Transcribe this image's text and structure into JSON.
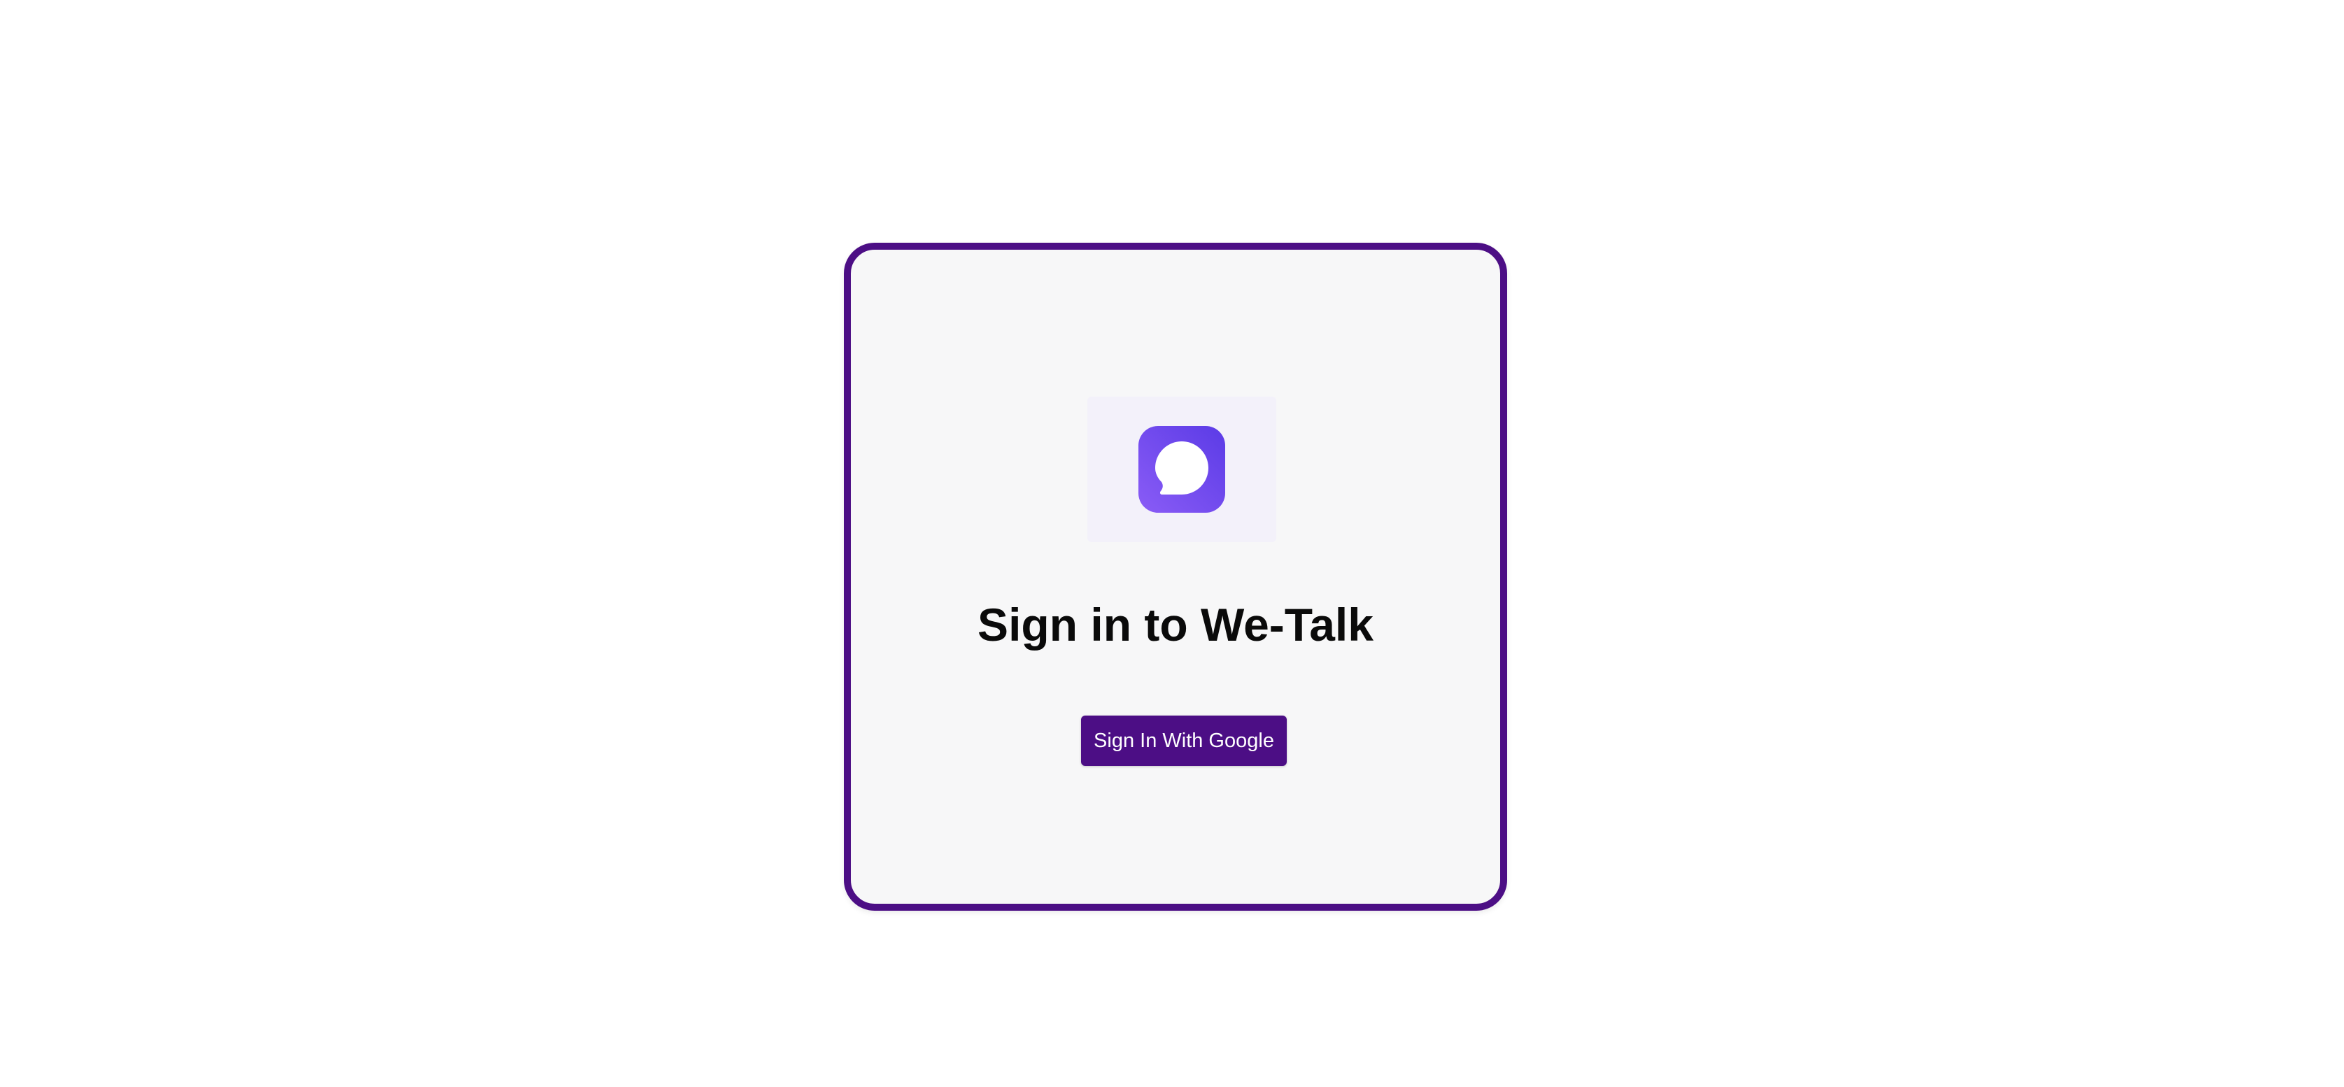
{
  "colors": {
    "accent": "#4c0e85",
    "card_background": "#f7f7f8",
    "logo_gradient_start": "#8a5cf6",
    "logo_gradient_end": "#5b3be6"
  },
  "logo": {
    "icon": "chat-bubble-icon"
  },
  "auth": {
    "title": "Sign in to We-Talk",
    "google_button_label": "Sign In With Google"
  }
}
